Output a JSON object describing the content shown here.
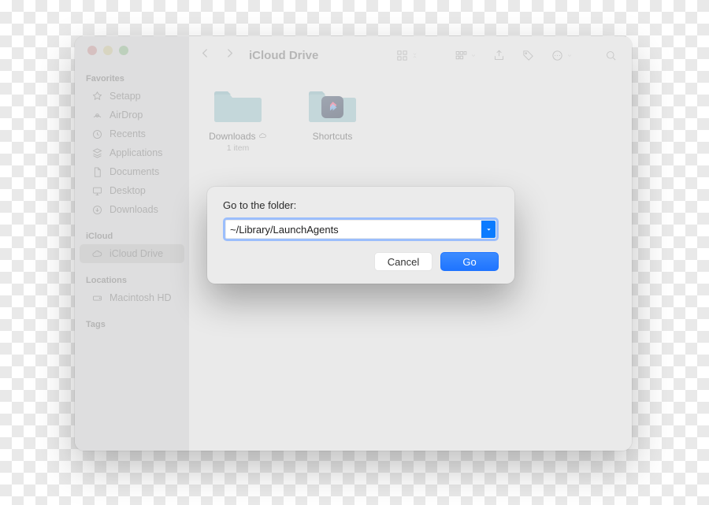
{
  "window_title": "iCloud Drive",
  "traffic_lights": [
    "close",
    "minimize",
    "zoom"
  ],
  "sidebar": {
    "sections": [
      {
        "header": "Favorites",
        "items": [
          {
            "icon": "setapp-icon",
            "label": "Setapp"
          },
          {
            "icon": "airdrop-icon",
            "label": "AirDrop"
          },
          {
            "icon": "clock-icon",
            "label": "Recents"
          },
          {
            "icon": "grid-icon",
            "label": "Applications"
          },
          {
            "icon": "document-icon",
            "label": "Documents"
          },
          {
            "icon": "desktop-icon",
            "label": "Desktop"
          },
          {
            "icon": "download-icon",
            "label": "Downloads"
          }
        ]
      },
      {
        "header": "iCloud",
        "items": [
          {
            "icon": "cloud-icon",
            "label": "iCloud Drive",
            "selected": true
          }
        ]
      },
      {
        "header": "Locations",
        "items": [
          {
            "icon": "disk-icon",
            "label": "Macintosh HD"
          }
        ]
      },
      {
        "header": "Tags",
        "items": []
      }
    ]
  },
  "toolbar_icons": [
    "back",
    "forward",
    "view-grid",
    "view-group",
    "share",
    "tags",
    "actions",
    "search"
  ],
  "content": {
    "items": [
      {
        "name": "Downloads",
        "sub": "1 item",
        "type": "folder",
        "cloud": true
      },
      {
        "name": "Shortcuts",
        "type": "app-folder"
      }
    ]
  },
  "dialog": {
    "title": "Go to the folder:",
    "path_value": "~/Library/LaunchAgents",
    "cancel_label": "Cancel",
    "go_label": "Go"
  }
}
